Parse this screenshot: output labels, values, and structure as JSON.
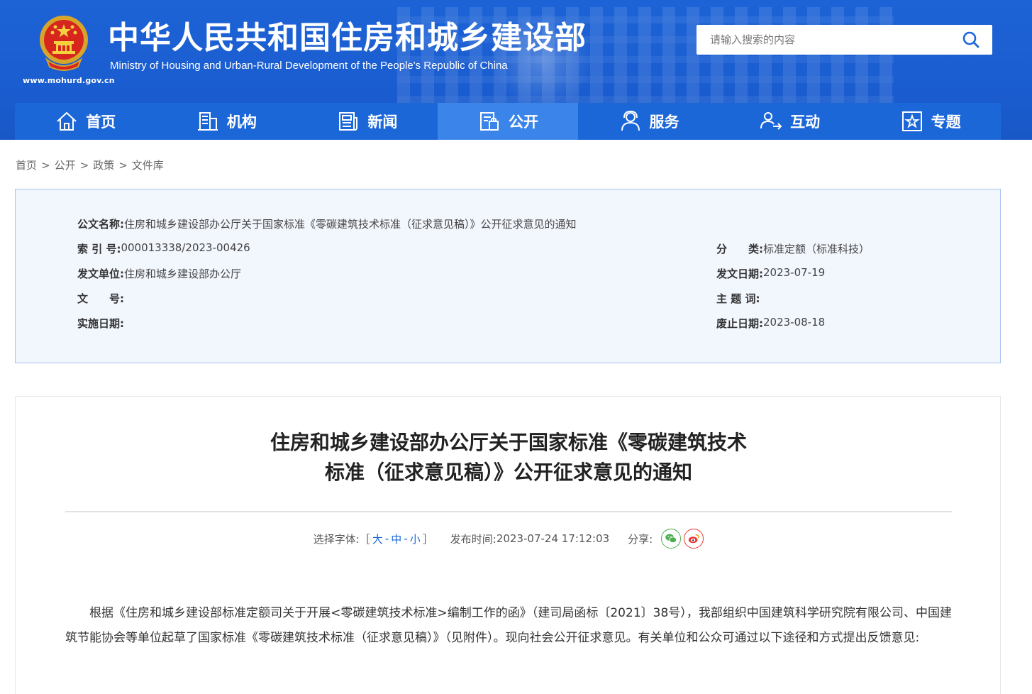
{
  "header": {
    "title_cn": "中华人民共和国住房和城乡建设部",
    "title_en": "Ministry of Housing and Urban-Rural Development of the People's Republic of China",
    "url": "www.mohurd.gov.cn",
    "search_placeholder": "请输入搜索的内容"
  },
  "nav": {
    "items": [
      {
        "label": "首页",
        "icon": "home-icon"
      },
      {
        "label": "机构",
        "icon": "building-icon"
      },
      {
        "label": "新闻",
        "icon": "news-icon"
      },
      {
        "label": "公开",
        "icon": "disclosure-icon",
        "active": true
      },
      {
        "label": "服务",
        "icon": "service-icon"
      },
      {
        "label": "互动",
        "icon": "interaction-icon"
      },
      {
        "label": "专题",
        "icon": "topic-icon"
      }
    ]
  },
  "breadcrumb": [
    "首页",
    "公开",
    "政策",
    "文件库"
  ],
  "info": {
    "name_label": "公文名称:",
    "name_value": "住房和城乡建设部办公厅关于国家标准《零碳建筑技术标准（征求意见稿）》公开征求意见的通知",
    "index_label": "索 引 号:",
    "index_value": "000013338/2023-00426",
    "category_label": "分　　类:",
    "category_value": "标准定额（标准科技）",
    "issuer_label": "发文单位:",
    "issuer_value": "住房和城乡建设部办公厅",
    "issue_date_label": "发文日期:",
    "issue_date_value": "2023-07-19",
    "doc_no_label": "文　　号:",
    "doc_no_value": "",
    "keywords_label": "主 题 词:",
    "keywords_value": "",
    "effective_label": "实施日期:",
    "effective_value": "",
    "expiry_label": "废止日期:",
    "expiry_value": "2023-08-18"
  },
  "article": {
    "title_line1": "住房和城乡建设部办公厅关于国家标准《零碳建筑技术",
    "title_line2": "标准（征求意见稿）》公开征求意见的通知",
    "font_select_label": "选择字体:",
    "font_large": "大",
    "font_medium": "中",
    "font_small": "小",
    "publish_label": "发布时间:",
    "publish_time": "2023-07-24 17:12:03",
    "share_label": "分享:",
    "body": "根据《住房和城乡建设部标准定额司关于开展<零碳建筑技术标准>编制工作的函》（建司局函标〔2021〕38号），我部组织中国建筑科学研究院有限公司、中国建筑节能协会等单位起草了国家标准《零碳建筑技术标准（征求意见稿）》（见附件）。现向社会公开征求意见。有关单位和公众可通过以下途径和方式提出反馈意见:"
  },
  "colors": {
    "header_blue": "#1d63d6",
    "nav_blue": "#1c67d8",
    "nav_active": "#3b85ea",
    "info_bg": "#f2f6fd",
    "link_blue": "#1c67d8"
  }
}
